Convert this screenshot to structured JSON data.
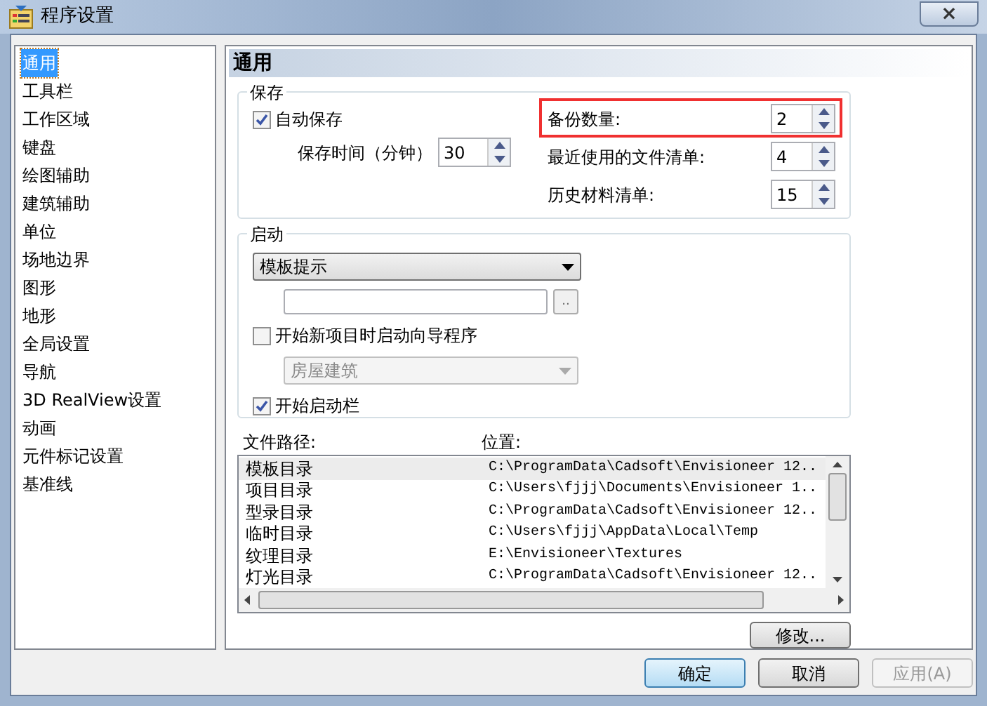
{
  "window": {
    "title": "程序设置",
    "close": "×"
  },
  "sidebar": {
    "items": [
      {
        "label": "通用",
        "selected": true
      },
      {
        "label": "工具栏",
        "selected": false
      },
      {
        "label": "工作区域",
        "selected": false
      },
      {
        "label": "键盘",
        "selected": false
      },
      {
        "label": "绘图辅助",
        "selected": false
      },
      {
        "label": "建筑辅助",
        "selected": false
      },
      {
        "label": "单位",
        "selected": false
      },
      {
        "label": "场地边界",
        "selected": false
      },
      {
        "label": "图形",
        "selected": false
      },
      {
        "label": "地形",
        "selected": false
      },
      {
        "label": "全局设置",
        "selected": false
      },
      {
        "label": "导航",
        "selected": false
      },
      {
        "label": "3D RealView设置",
        "selected": false
      },
      {
        "label": "动画",
        "selected": false
      },
      {
        "label": "元件标记设置",
        "selected": false
      },
      {
        "label": "基准线",
        "selected": false
      }
    ]
  },
  "panel_title": "通用",
  "save_group": {
    "title": "保存",
    "autosave": {
      "label": "自动保存",
      "checked": true
    },
    "interval": {
      "label": "保存时间（分钟）",
      "value": "30"
    },
    "spinners": [
      {
        "label": "备份数量:",
        "value": "2",
        "highlighted": true
      },
      {
        "label": "最近使用的文件清单:",
        "value": "4",
        "highlighted": false
      },
      {
        "label": "历史材料清单:",
        "value": "15",
        "highlighted": false
      }
    ]
  },
  "startup_group": {
    "title": "启动",
    "template_dropdown": {
      "value": "模板提示"
    },
    "browse_button": "..",
    "wizard": {
      "label": "开始新项目时启动向导程序",
      "checked": false
    },
    "type_dropdown": {
      "value": "房屋建筑",
      "disabled": true
    },
    "startbar": {
      "label": "开始启动栏",
      "checked": true
    }
  },
  "file_paths": {
    "columns": [
      "文件路径:",
      "位置:"
    ],
    "rows": [
      {
        "name": "模板目录",
        "path": "C:\\ProgramData\\Cadsoft\\Envisioneer 12..",
        "selected": true
      },
      {
        "name": "项目目录",
        "path": "C:\\Users\\fjjj\\Documents\\Envisioneer 1..",
        "selected": false
      },
      {
        "name": "型录目录",
        "path": "C:\\ProgramData\\Cadsoft\\Envisioneer 12..",
        "selected": false
      },
      {
        "name": "临时目录",
        "path": "C:\\Users\\fjjj\\AppData\\Local\\Temp",
        "selected": false
      },
      {
        "name": "纹理目录",
        "path": "E:\\Envisioneer\\Textures",
        "selected": false
      },
      {
        "name": "灯光目录",
        "path": "C:\\ProgramData\\Cadsoft\\Envisioneer 12..",
        "selected": false
      }
    ],
    "modify_button": "修改..."
  },
  "buttons": [
    {
      "label": "确定",
      "disabled": false,
      "default": true
    },
    {
      "label": "取消",
      "disabled": false,
      "default": false
    },
    {
      "label": "应用(A)",
      "disabled": true,
      "default": false
    }
  ]
}
